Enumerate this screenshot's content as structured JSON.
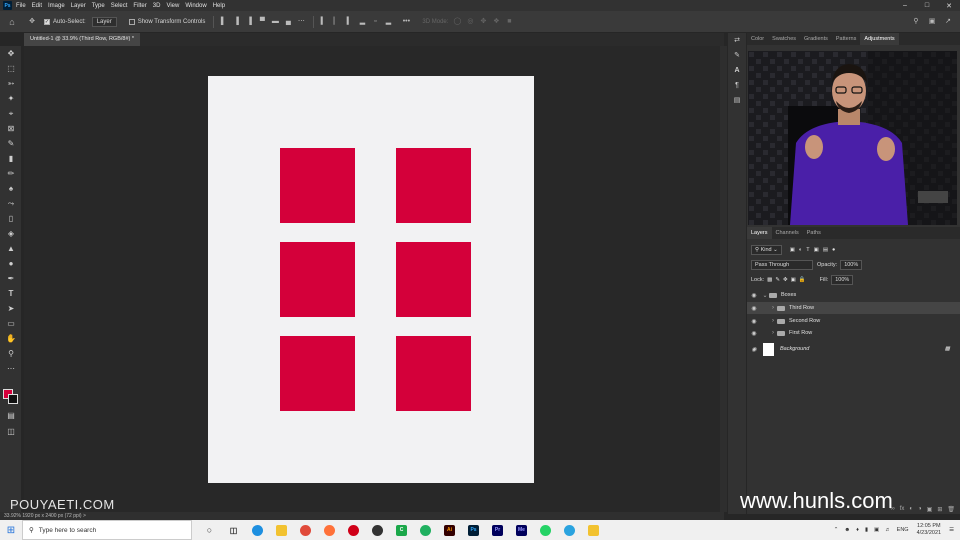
{
  "app": {
    "logo": "Ps",
    "menu": [
      "File",
      "Edit",
      "Image",
      "Layer",
      "Type",
      "Select",
      "Filter",
      "3D",
      "View",
      "Window",
      "Help"
    ]
  },
  "options": {
    "auto_select_label": "Auto-Select:",
    "auto_select_target": "Layer",
    "transform_label": "Show Transform Controls",
    "mode_3d": "3D Mode:"
  },
  "document": {
    "tab_label": "Untitled-1 @ 33.9% (Third Row, RGB/8#) *",
    "status": "33.92%   1920 px x 2400 px (72 ppi)   >"
  },
  "colors": {
    "accent_box": "#d4003a",
    "foreground": "#d4003a",
    "background": "#111111"
  },
  "panels": {
    "top_tabs": [
      "Color",
      "Swatches",
      "Gradients",
      "Patterns",
      "Adjustments"
    ],
    "active_top_tab": "Adjustments",
    "layer_tabs": [
      "Layers",
      "Channels",
      "Paths"
    ],
    "filter_kind": "Kind",
    "blend_mode": "Pass Through",
    "opacity_label": "Opacity:",
    "opacity_value": "100%",
    "lock_label": "Lock:",
    "fill_label": "Fill:",
    "fill_value": "100%"
  },
  "layers": {
    "group": "Boxes",
    "items": [
      "Third Row",
      "Second Row",
      "First Row"
    ],
    "selected": "Third Row",
    "background": "Background"
  },
  "watermarks": {
    "left": "POUYAETI.COM",
    "right": "www.hunls.com"
  },
  "taskbar": {
    "search_placeholder": "Type here to search",
    "language": "ENG",
    "time": "12:05 PM",
    "date": "4/23/2021"
  }
}
